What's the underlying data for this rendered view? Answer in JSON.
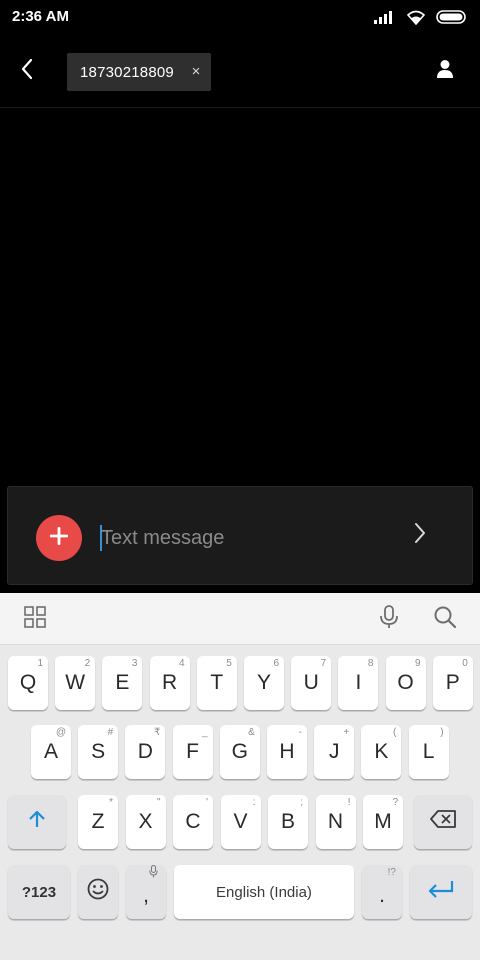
{
  "status_bar": {
    "time": "2:36 AM",
    "icons": [
      "signal-icon",
      "wifi-icon",
      "battery-icon"
    ]
  },
  "header": {
    "back_icon": "back-arrow-icon",
    "recipient": "18730218809",
    "remove_glyph": "×",
    "contact_icon": "person-icon"
  },
  "compose": {
    "placeholder": "Text message",
    "value": "",
    "attach_icon": "plus-icon",
    "send_icon": "chevron-right-icon",
    "accent": "#e84a47"
  },
  "keyboard": {
    "toolbar": {
      "left_icon": "apps-grid-icon",
      "right_icons": [
        "mic-icon",
        "search-icon"
      ]
    },
    "row1": [
      {
        "label": "Q",
        "hint": "1"
      },
      {
        "label": "W",
        "hint": "2"
      },
      {
        "label": "E",
        "hint": "3"
      },
      {
        "label": "R",
        "hint": "4"
      },
      {
        "label": "T",
        "hint": "5"
      },
      {
        "label": "Y",
        "hint": "6"
      },
      {
        "label": "U",
        "hint": "7"
      },
      {
        "label": "I",
        "hint": "8"
      },
      {
        "label": "O",
        "hint": "9"
      },
      {
        "label": "P",
        "hint": "0"
      }
    ],
    "row2": [
      {
        "label": "A",
        "hint": "@"
      },
      {
        "label": "S",
        "hint": "#"
      },
      {
        "label": "D",
        "hint": "₹"
      },
      {
        "label": "F",
        "hint": "_"
      },
      {
        "label": "G",
        "hint": "&"
      },
      {
        "label": "H",
        "hint": "-"
      },
      {
        "label": "J",
        "hint": "+"
      },
      {
        "label": "K",
        "hint": "("
      },
      {
        "label": "L",
        "hint": ")"
      }
    ],
    "row3": [
      {
        "label": "Z",
        "hint": "*"
      },
      {
        "label": "X",
        "hint": "\""
      },
      {
        "label": "C",
        "hint": "'"
      },
      {
        "label": "V",
        "hint": ":"
      },
      {
        "label": "B",
        "hint": ";"
      },
      {
        "label": "N",
        "hint": "!"
      },
      {
        "label": "M",
        "hint": "?"
      }
    ],
    "row4": {
      "symbols": "?123",
      "comma": ",",
      "space": "English (India)",
      "period": ".",
      "period_hint": "!?"
    },
    "accent": "#1a8fd8"
  }
}
